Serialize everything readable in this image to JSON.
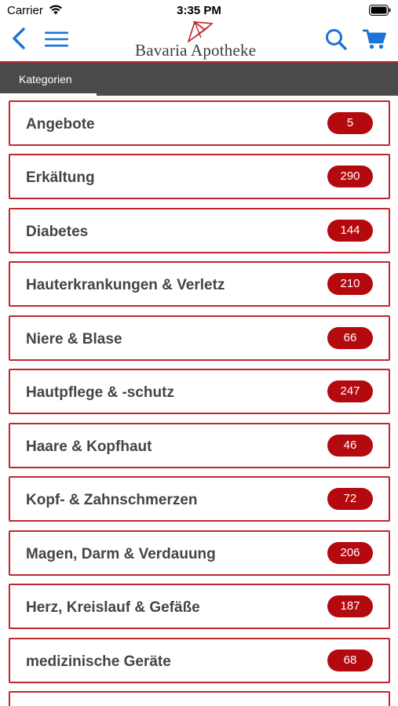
{
  "status_bar": {
    "carrier": "Carrier",
    "time": "3:35 PM"
  },
  "header": {
    "logo_text": "Bavaria Apotheke",
    "accent_color": "#1a73d9",
    "brand_red": "#c0272d"
  },
  "tabs": [
    {
      "label": "Kategorien",
      "active": true
    }
  ],
  "categories": [
    {
      "label": "Angebote",
      "count": "5"
    },
    {
      "label": "Erkältung",
      "count": "290"
    },
    {
      "label": "Diabetes",
      "count": "144"
    },
    {
      "label": "Hauterkrankungen & Verletz",
      "count": "210"
    },
    {
      "label": "Niere & Blase",
      "count": "66"
    },
    {
      "label": "Hautpflege & -schutz",
      "count": "247"
    },
    {
      "label": "Haare & Kopfhaut",
      "count": "46"
    },
    {
      "label": "Kopf- & Zahnschmerzen",
      "count": "72"
    },
    {
      "label": "Magen, Darm & Verdauung",
      "count": "206"
    },
    {
      "label": "Herz, Kreislauf & Gefäße",
      "count": "187"
    },
    {
      "label": "medizinische Geräte",
      "count": "68"
    }
  ]
}
